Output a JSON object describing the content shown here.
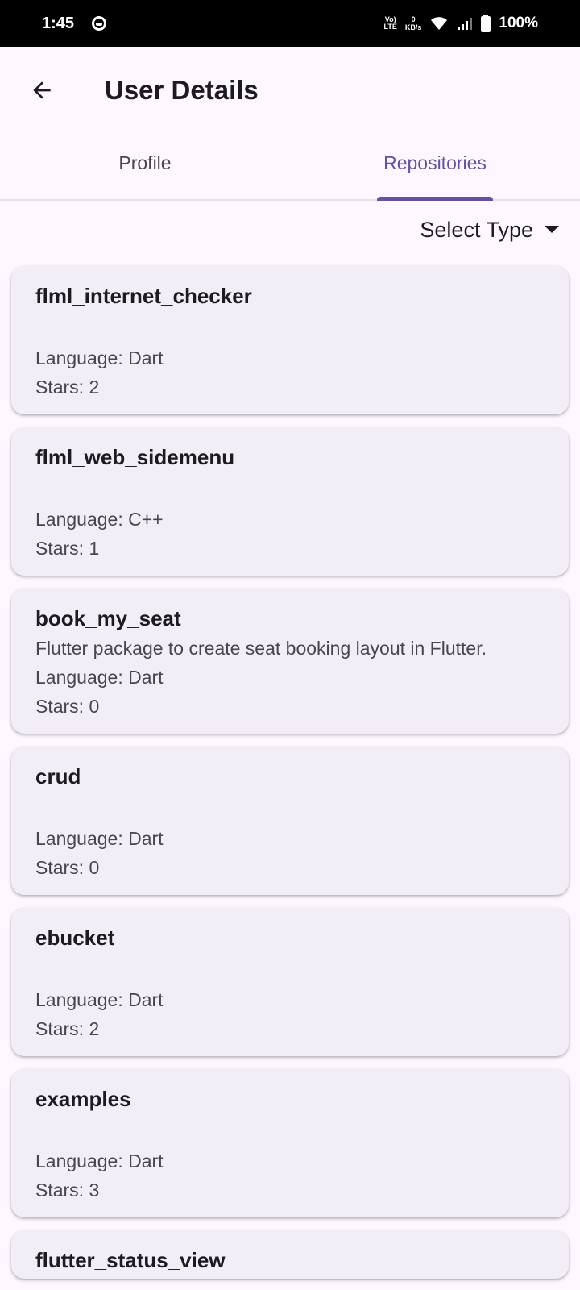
{
  "status_bar": {
    "time": "1:45",
    "network_top": "Vo)",
    "network_bottom": "LTE",
    "speed_value": "0",
    "speed_unit": "KB/s",
    "battery": "100%"
  },
  "app_bar": {
    "title": "User Details",
    "back_icon": "arrow-back-icon"
  },
  "tabs": [
    {
      "label": "Profile",
      "active": false
    },
    {
      "label": "Repositories",
      "active": true
    }
  ],
  "filter": {
    "label": "Select Type",
    "icon": "dropdown-arrow-icon"
  },
  "repositories": [
    {
      "name": "flml_internet_checker",
      "description": "",
      "language": "Language: Dart",
      "stars": "Stars: 2"
    },
    {
      "name": "flml_web_sidemenu",
      "description": "",
      "language": "Language: C++",
      "stars": "Stars: 1"
    },
    {
      "name": "book_my_seat",
      "description": "Flutter package to create seat booking layout in Flutter.",
      "language": "Language: Dart",
      "stars": "Stars: 0"
    },
    {
      "name": "crud",
      "description": "",
      "language": "Language: Dart",
      "stars": "Stars: 0"
    },
    {
      "name": "ebucket",
      "description": "",
      "language": "Language: Dart",
      "stars": "Stars: 2"
    },
    {
      "name": "examples",
      "description": "",
      "language": "Language: Dart",
      "stars": "Stars: 3"
    },
    {
      "name": "flutter_status_view",
      "description": "",
      "language": "",
      "stars": ""
    }
  ],
  "colors": {
    "accent": "#6750a4",
    "card": "#f3edf7",
    "background": "#fef7ff"
  }
}
